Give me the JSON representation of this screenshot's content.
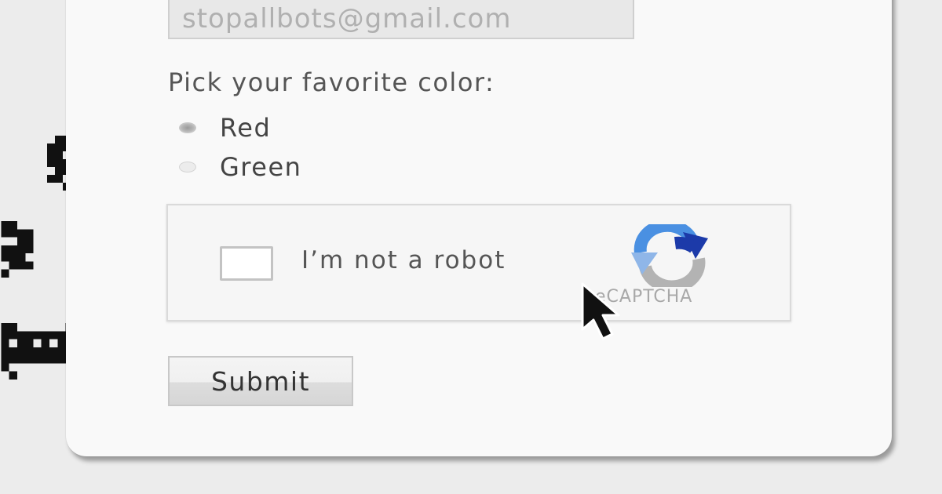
{
  "form": {
    "email_value": "stopallbots@gmail.com",
    "color_prompt": "Pick your favorite color:",
    "color_options": [
      {
        "label": "Red",
        "checked": true
      },
      {
        "label": "Green",
        "checked": false
      }
    ],
    "captcha": {
      "label": "I’m not a robot",
      "brand": "eCAPTCHA",
      "checked": false,
      "icon": "recaptcha-logo-icon"
    },
    "submit_label": "Submit"
  },
  "decorations": {
    "bot_icon": "pixel-bot-icon",
    "cursor_icon": "mouse-pointer-icon"
  },
  "colors": {
    "background": "#ececec",
    "card": "#f9f9f9",
    "recaptcha_blue": "#4a90e2",
    "recaptcha_dark_blue": "#1c3aa9",
    "recaptcha_gray": "#b3b3b3"
  }
}
